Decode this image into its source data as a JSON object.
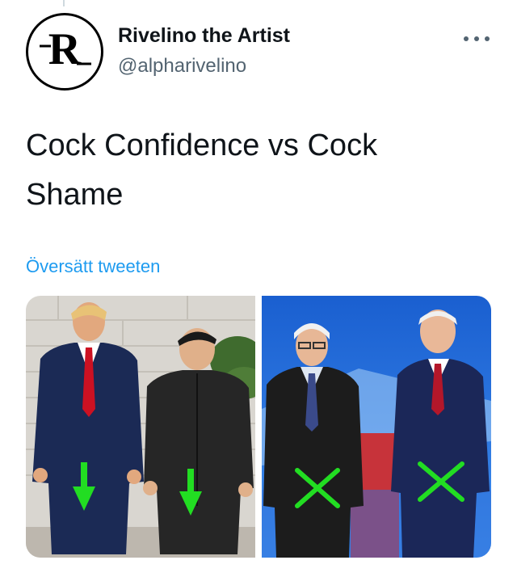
{
  "tweet": {
    "display_name": "Rivelino the Artist",
    "handle": "@alpharivelino",
    "avatar_letter": "R",
    "text": "Cock Confidence vs Cock Shame",
    "translate_label": "Översätt tweeten",
    "more_icon": "more-horizontal-icon"
  },
  "media": {
    "photos": [
      {
        "name": "left-photo",
        "marker": "down-arrows",
        "marker_color": "#22dd22"
      },
      {
        "name": "right-photo",
        "marker": "x-marks",
        "marker_color": "#22dd22"
      }
    ]
  },
  "colors": {
    "link": "#1d9bf0",
    "secondary_text": "#536471",
    "primary_text": "#0f1419"
  }
}
